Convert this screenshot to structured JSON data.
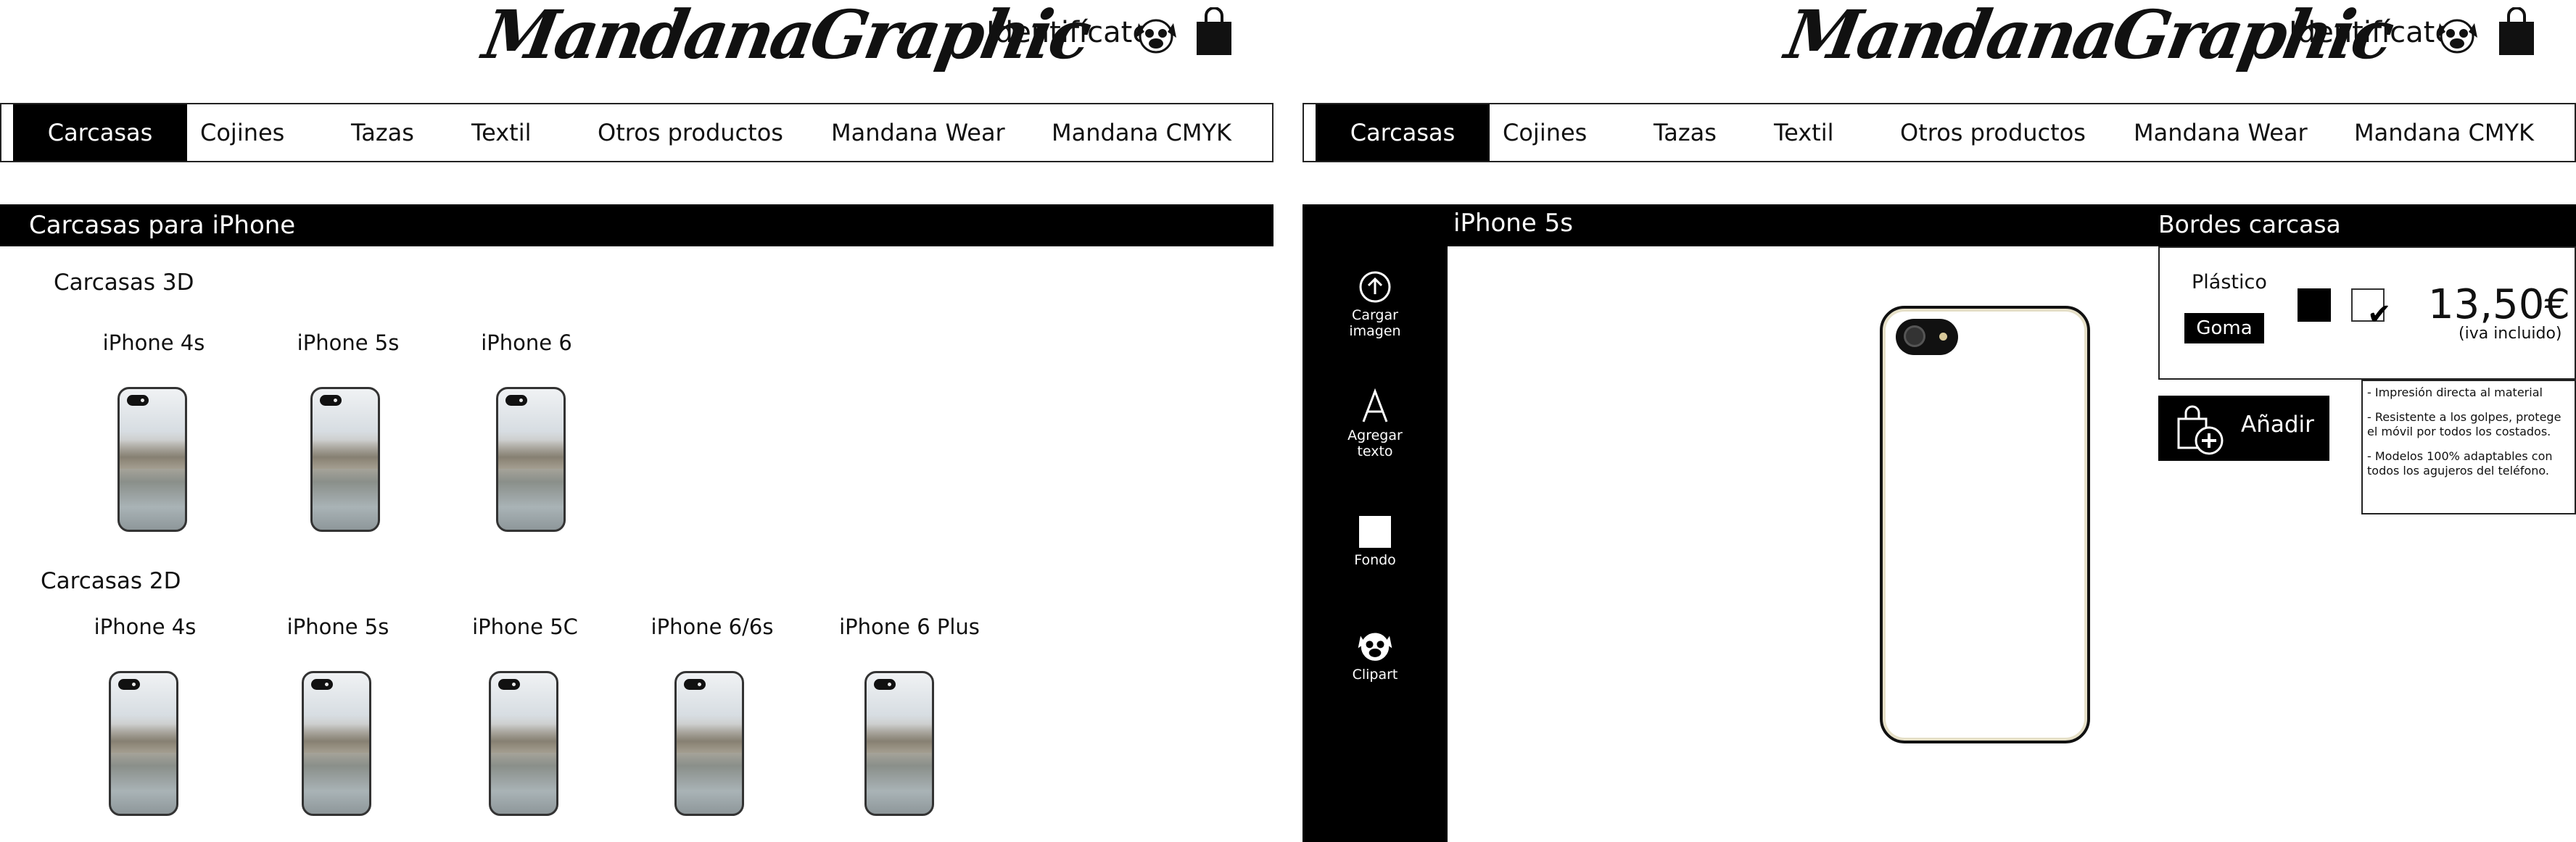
{
  "brand": {
    "logo_text": "MandanaGraphic"
  },
  "header": {
    "login_label": "Identifícate"
  },
  "nav": {
    "items": [
      "Carcasas",
      "Cojines",
      "Tazas",
      "Textil",
      "Otros productos",
      "Mandana Wear",
      "Mandana CMYK"
    ],
    "active": "Carcasas"
  },
  "listing": {
    "section_title": "Carcasas para iPhone",
    "groups": [
      {
        "title": "Carcasas 3D",
        "models": [
          "iPhone 4s",
          "iPhone 5s",
          "iPhone 6"
        ]
      },
      {
        "title": "Carcasas 2D",
        "models": [
          "iPhone 4s",
          "iPhone 5s",
          "iPhone 5C",
          "iPhone 6/6s",
          "iPhone 6 Plus"
        ]
      }
    ]
  },
  "editor": {
    "title": "iPhone 5s",
    "tools": [
      {
        "label_1": "Cargar",
        "label_2": "imagen",
        "icon": "upload-icon"
      },
      {
        "label_1": "Agregar",
        "label_2": "texto",
        "icon": "text-icon"
      },
      {
        "label_1": "Fondo",
        "label_2": "",
        "icon": "background-square-icon"
      },
      {
        "label_1": "Clipart",
        "label_2": "",
        "icon": "pug-icon"
      }
    ],
    "options_title": "Bordes carcasa",
    "materials": [
      "Plástico",
      "Goma"
    ],
    "selected_material": "Goma",
    "colors": [
      {
        "name": "black",
        "hex": "#000000"
      },
      {
        "name": "white",
        "hex": "#ffffff",
        "selected": true
      }
    ],
    "price": "13,50€",
    "price_note": "(iva incluido)",
    "add_button_label": "Añadir",
    "features": [
      "- Impresión directa al material",
      "- Resistente a los golpes, protege el móvil por todos los costados.",
      "- Modelos 100% adaptables con todos los agujeros del teléfono."
    ]
  },
  "colors": {
    "accent": "#000000",
    "background": "#ffffff"
  }
}
